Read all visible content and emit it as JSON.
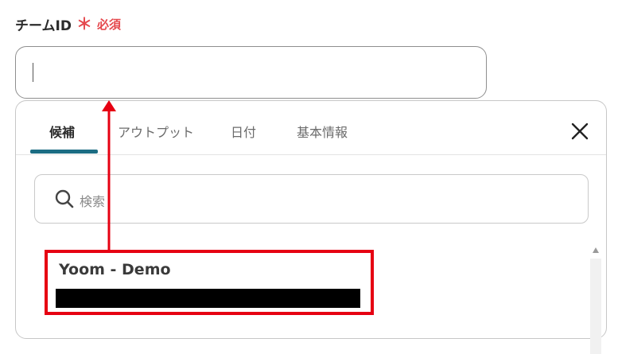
{
  "form": {
    "label": "チームID",
    "required_mark": "＊",
    "required_text": "必須",
    "value": ""
  },
  "picker": {
    "tabs": [
      {
        "label": "候補",
        "active": true
      },
      {
        "label": "アウトプット",
        "active": false
      },
      {
        "label": "日付",
        "active": false
      },
      {
        "label": "基本情報",
        "active": false
      }
    ],
    "close_icon": "close-icon",
    "search": {
      "placeholder": "検索",
      "icon": "search-icon"
    },
    "candidates": [
      {
        "name": "Yoom - Demo",
        "detail_redacted": true
      }
    ]
  },
  "colors": {
    "required": "#e5484d",
    "active_tab_underline": "#1c6d83",
    "annotation_red": "#e60012"
  }
}
